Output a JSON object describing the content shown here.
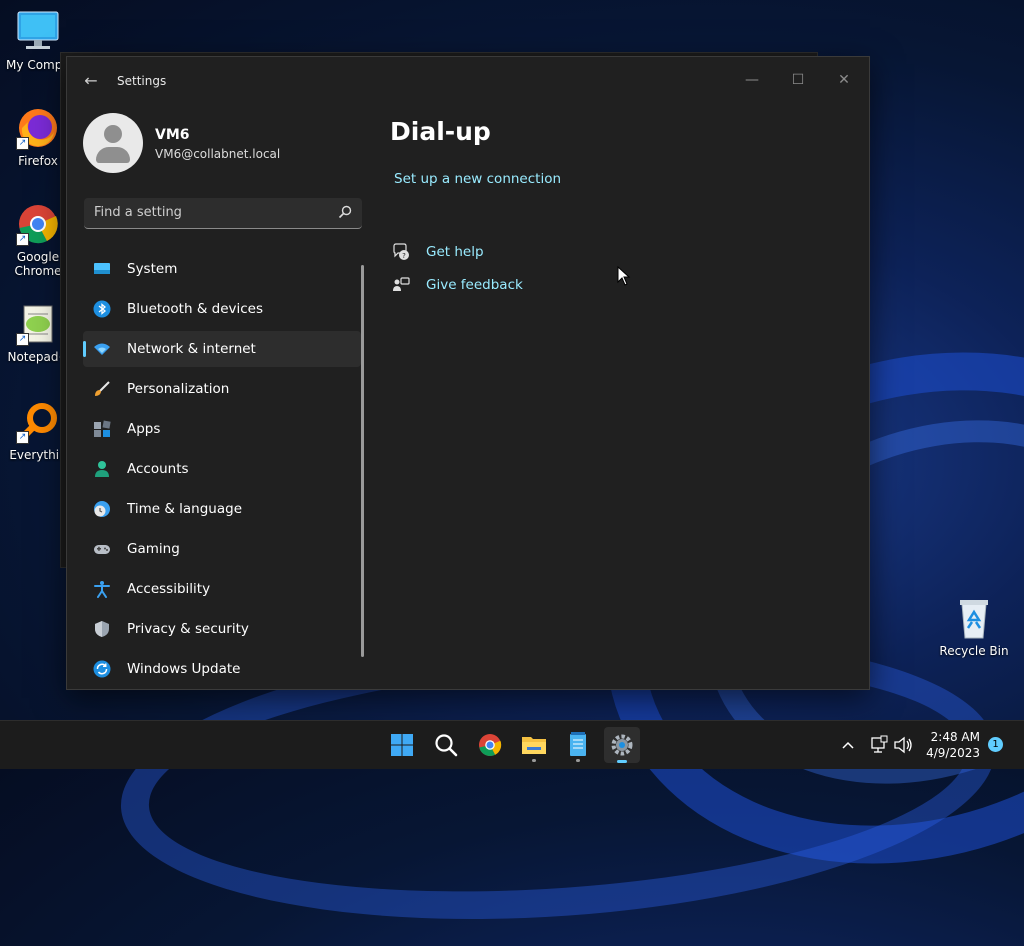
{
  "desktop": {
    "icons": [
      {
        "label": "My Compu"
      },
      {
        "label": "Firefox"
      },
      {
        "label": "Google Chrome"
      },
      {
        "label": "Notepad+"
      },
      {
        "label": "Everythin"
      },
      {
        "label": "Recycle Bin"
      }
    ]
  },
  "window": {
    "title": "Settings",
    "back_glyph": "←",
    "minimize_glyph": "—",
    "maximize_glyph": "☐",
    "close_glyph": "✕"
  },
  "profile": {
    "name": "VM6",
    "email": "VM6@collabnet.local"
  },
  "search": {
    "placeholder": "Find a setting"
  },
  "nav": {
    "items": [
      {
        "label": "System",
        "icon": "system-icon"
      },
      {
        "label": "Bluetooth & devices",
        "icon": "bluetooth-icon"
      },
      {
        "label": "Network & internet",
        "icon": "network-icon",
        "active": true
      },
      {
        "label": "Personalization",
        "icon": "brush-icon"
      },
      {
        "label": "Apps",
        "icon": "apps-icon"
      },
      {
        "label": "Accounts",
        "icon": "accounts-icon"
      },
      {
        "label": "Time & language",
        "icon": "time-language-icon"
      },
      {
        "label": "Gaming",
        "icon": "gamepad-icon"
      },
      {
        "label": "Accessibility",
        "icon": "accessibility-icon"
      },
      {
        "label": "Privacy & security",
        "icon": "shield-icon"
      },
      {
        "label": "Windows Update",
        "icon": "update-icon"
      }
    ]
  },
  "content": {
    "title": "Dial-up",
    "setup_link": "Set up a new connection",
    "help_link": "Get help",
    "feedback_link": "Give feedback"
  },
  "taskbar": {
    "time": "2:48 AM",
    "date": "4/9/2023",
    "notification_count": "1"
  },
  "colors": {
    "accent": "#60cdff",
    "link": "#99ebff",
    "window_bg": "#202020"
  }
}
